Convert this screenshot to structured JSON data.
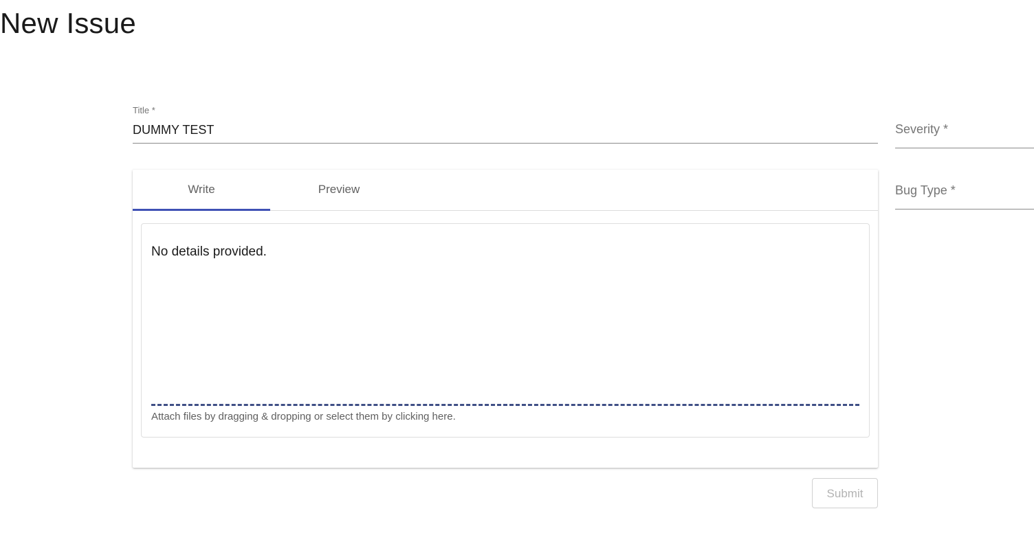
{
  "page": {
    "title": "New Issue"
  },
  "form": {
    "title_label": "Title *",
    "title_value": "DUMMY TEST",
    "severity_label": "Severity *",
    "bug_type_label": "Bug Type *",
    "submit_label": "Submit"
  },
  "editor": {
    "tabs": [
      {
        "label": "Write",
        "active": true
      },
      {
        "label": "Preview",
        "active": false
      }
    ],
    "content": "No details provided.",
    "attach_text": "Attach files by dragging & dropping or select them by clicking here."
  },
  "colors": {
    "accent": "#3f51b5",
    "dropzone_border": "#3f4f86"
  }
}
